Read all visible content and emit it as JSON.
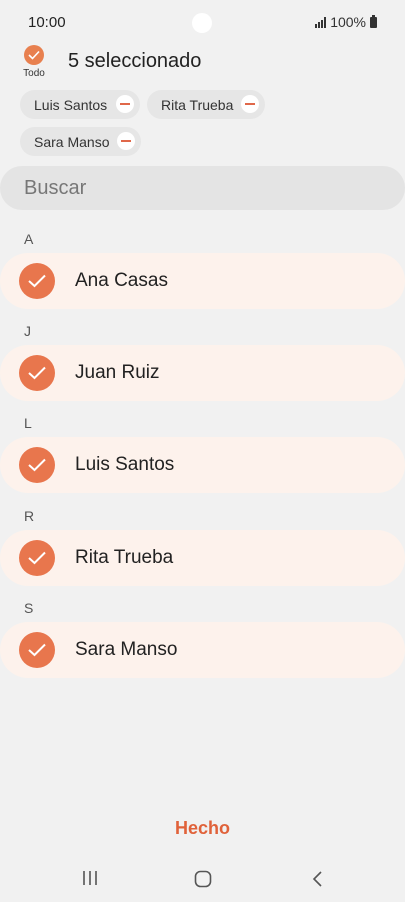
{
  "status": {
    "time": "10:00",
    "battery": "100%"
  },
  "header": {
    "select_all_label": "Todo",
    "selected_count": "5 seleccionado"
  },
  "chips": [
    {
      "label": "Luis Santos"
    },
    {
      "label": "Rita Trueba"
    },
    {
      "label": "Sara Manso"
    }
  ],
  "search": {
    "placeholder": "Buscar"
  },
  "sections": [
    {
      "letter": "A",
      "contact": "Ana Casas"
    },
    {
      "letter": "J",
      "contact": "Juan Ruiz"
    },
    {
      "letter": "L",
      "contact": "Luis Santos"
    },
    {
      "letter": "R",
      "contact": "Rita Trueba"
    },
    {
      "letter": "S",
      "contact": "Sara Manso"
    }
  ],
  "footer": {
    "done_label": "Hecho"
  },
  "colors": {
    "accent": "#e8764d",
    "row_bg": "#fdf2ec",
    "done_text": "#e0623a"
  },
  "icons": {
    "check": "check-icon",
    "remove": "minus-circle-icon",
    "recents": "recents-icon",
    "home": "home-icon",
    "back": "back-icon"
  }
}
